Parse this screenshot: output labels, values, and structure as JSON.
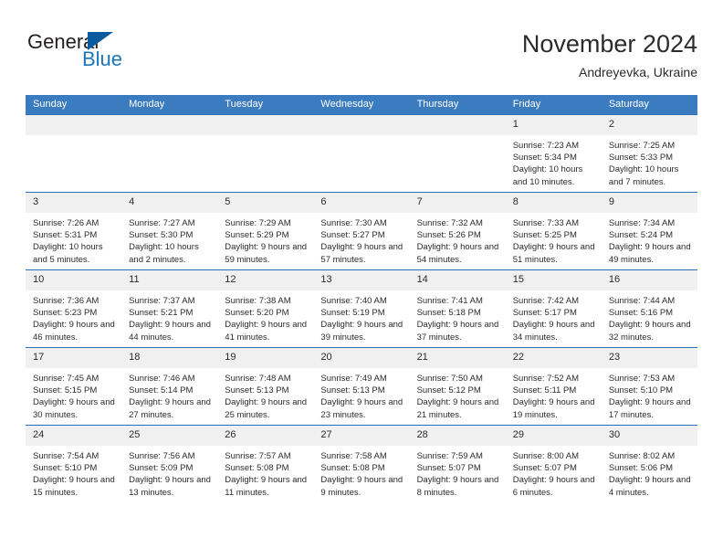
{
  "logo": {
    "line1": "General",
    "line2": "Blue",
    "triangle_icon": "triangle-icon",
    "color_dark": "#231f20",
    "color_blue": "#1b75bb"
  },
  "header": {
    "title": "November 2024",
    "subtitle": "Andreyevka, Ukraine"
  },
  "theme": {
    "header_blue": "#3b7cc0",
    "grid_line": "#2d6fb5",
    "daynum_bg": "#f0f0f0"
  },
  "weekday_headers": [
    "Sunday",
    "Monday",
    "Tuesday",
    "Wednesday",
    "Thursday",
    "Friday",
    "Saturday"
  ],
  "weeks": [
    [
      {
        "day": "",
        "sunrise": "",
        "sunset": "",
        "daylight": ""
      },
      {
        "day": "",
        "sunrise": "",
        "sunset": "",
        "daylight": ""
      },
      {
        "day": "",
        "sunrise": "",
        "sunset": "",
        "daylight": ""
      },
      {
        "day": "",
        "sunrise": "",
        "sunset": "",
        "daylight": ""
      },
      {
        "day": "",
        "sunrise": "",
        "sunset": "",
        "daylight": ""
      },
      {
        "day": "1",
        "sunrise": "Sunrise: 7:23 AM",
        "sunset": "Sunset: 5:34 PM",
        "daylight": "Daylight: 10 hours and 10 minutes."
      },
      {
        "day": "2",
        "sunrise": "Sunrise: 7:25 AM",
        "sunset": "Sunset: 5:33 PM",
        "daylight": "Daylight: 10 hours and 7 minutes."
      }
    ],
    [
      {
        "day": "3",
        "sunrise": "Sunrise: 7:26 AM",
        "sunset": "Sunset: 5:31 PM",
        "daylight": "Daylight: 10 hours and 5 minutes."
      },
      {
        "day": "4",
        "sunrise": "Sunrise: 7:27 AM",
        "sunset": "Sunset: 5:30 PM",
        "daylight": "Daylight: 10 hours and 2 minutes."
      },
      {
        "day": "5",
        "sunrise": "Sunrise: 7:29 AM",
        "sunset": "Sunset: 5:29 PM",
        "daylight": "Daylight: 9 hours and 59 minutes."
      },
      {
        "day": "6",
        "sunrise": "Sunrise: 7:30 AM",
        "sunset": "Sunset: 5:27 PM",
        "daylight": "Daylight: 9 hours and 57 minutes."
      },
      {
        "day": "7",
        "sunrise": "Sunrise: 7:32 AM",
        "sunset": "Sunset: 5:26 PM",
        "daylight": "Daylight: 9 hours and 54 minutes."
      },
      {
        "day": "8",
        "sunrise": "Sunrise: 7:33 AM",
        "sunset": "Sunset: 5:25 PM",
        "daylight": "Daylight: 9 hours and 51 minutes."
      },
      {
        "day": "9",
        "sunrise": "Sunrise: 7:34 AM",
        "sunset": "Sunset: 5:24 PM",
        "daylight": "Daylight: 9 hours and 49 minutes."
      }
    ],
    [
      {
        "day": "10",
        "sunrise": "Sunrise: 7:36 AM",
        "sunset": "Sunset: 5:23 PM",
        "daylight": "Daylight: 9 hours and 46 minutes."
      },
      {
        "day": "11",
        "sunrise": "Sunrise: 7:37 AM",
        "sunset": "Sunset: 5:21 PM",
        "daylight": "Daylight: 9 hours and 44 minutes."
      },
      {
        "day": "12",
        "sunrise": "Sunrise: 7:38 AM",
        "sunset": "Sunset: 5:20 PM",
        "daylight": "Daylight: 9 hours and 41 minutes."
      },
      {
        "day": "13",
        "sunrise": "Sunrise: 7:40 AM",
        "sunset": "Sunset: 5:19 PM",
        "daylight": "Daylight: 9 hours and 39 minutes."
      },
      {
        "day": "14",
        "sunrise": "Sunrise: 7:41 AM",
        "sunset": "Sunset: 5:18 PM",
        "daylight": "Daylight: 9 hours and 37 minutes."
      },
      {
        "day": "15",
        "sunrise": "Sunrise: 7:42 AM",
        "sunset": "Sunset: 5:17 PM",
        "daylight": "Daylight: 9 hours and 34 minutes."
      },
      {
        "day": "16",
        "sunrise": "Sunrise: 7:44 AM",
        "sunset": "Sunset: 5:16 PM",
        "daylight": "Daylight: 9 hours and 32 minutes."
      }
    ],
    [
      {
        "day": "17",
        "sunrise": "Sunrise: 7:45 AM",
        "sunset": "Sunset: 5:15 PM",
        "daylight": "Daylight: 9 hours and 30 minutes."
      },
      {
        "day": "18",
        "sunrise": "Sunrise: 7:46 AM",
        "sunset": "Sunset: 5:14 PM",
        "daylight": "Daylight: 9 hours and 27 minutes."
      },
      {
        "day": "19",
        "sunrise": "Sunrise: 7:48 AM",
        "sunset": "Sunset: 5:13 PM",
        "daylight": "Daylight: 9 hours and 25 minutes."
      },
      {
        "day": "20",
        "sunrise": "Sunrise: 7:49 AM",
        "sunset": "Sunset: 5:13 PM",
        "daylight": "Daylight: 9 hours and 23 minutes."
      },
      {
        "day": "21",
        "sunrise": "Sunrise: 7:50 AM",
        "sunset": "Sunset: 5:12 PM",
        "daylight": "Daylight: 9 hours and 21 minutes."
      },
      {
        "day": "22",
        "sunrise": "Sunrise: 7:52 AM",
        "sunset": "Sunset: 5:11 PM",
        "daylight": "Daylight: 9 hours and 19 minutes."
      },
      {
        "day": "23",
        "sunrise": "Sunrise: 7:53 AM",
        "sunset": "Sunset: 5:10 PM",
        "daylight": "Daylight: 9 hours and 17 minutes."
      }
    ],
    [
      {
        "day": "24",
        "sunrise": "Sunrise: 7:54 AM",
        "sunset": "Sunset: 5:10 PM",
        "daylight": "Daylight: 9 hours and 15 minutes."
      },
      {
        "day": "25",
        "sunrise": "Sunrise: 7:56 AM",
        "sunset": "Sunset: 5:09 PM",
        "daylight": "Daylight: 9 hours and 13 minutes."
      },
      {
        "day": "26",
        "sunrise": "Sunrise: 7:57 AM",
        "sunset": "Sunset: 5:08 PM",
        "daylight": "Daylight: 9 hours and 11 minutes."
      },
      {
        "day": "27",
        "sunrise": "Sunrise: 7:58 AM",
        "sunset": "Sunset: 5:08 PM",
        "daylight": "Daylight: 9 hours and 9 minutes."
      },
      {
        "day": "28",
        "sunrise": "Sunrise: 7:59 AM",
        "sunset": "Sunset: 5:07 PM",
        "daylight": "Daylight: 9 hours and 8 minutes."
      },
      {
        "day": "29",
        "sunrise": "Sunrise: 8:00 AM",
        "sunset": "Sunset: 5:07 PM",
        "daylight": "Daylight: 9 hours and 6 minutes."
      },
      {
        "day": "30",
        "sunrise": "Sunrise: 8:02 AM",
        "sunset": "Sunset: 5:06 PM",
        "daylight": "Daylight: 9 hours and 4 minutes."
      }
    ]
  ]
}
